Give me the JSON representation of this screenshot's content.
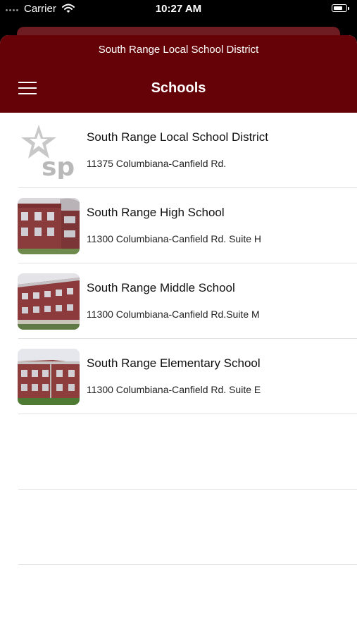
{
  "status_bar": {
    "carrier": "Carrier",
    "time": "10:27 AM",
    "icons": [
      "signal-dots",
      "wifi-icon",
      "battery-icon"
    ]
  },
  "header": {
    "subtitle": "South Range Local School District",
    "title": "Schools",
    "background_color": "#650208",
    "menu_icon": "hamburger-menu-icon"
  },
  "schools": [
    {
      "name": "South Range Local School District",
      "address": "11375 Columbiana-Canfield Rd.",
      "thumbnail": "sp-star-logo"
    },
    {
      "name": "South Range High School",
      "address": "11300 Columbiana-Canfield Rd. Suite H",
      "thumbnail": "building-photo"
    },
    {
      "name": "South Range Middle School",
      "address": "11300 Columbiana-Canfield Rd.Suite M",
      "thumbnail": "building-photo"
    },
    {
      "name": "South Range Elementary School",
      "address": "11300 Columbiana-Canfield Rd. Suite E",
      "thumbnail": "building-photo"
    }
  ]
}
